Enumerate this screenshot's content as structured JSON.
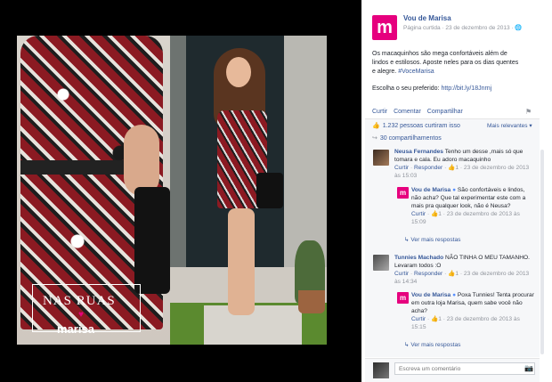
{
  "photo": {
    "brand_title": "NAS RUAS",
    "brand_logo": "marisa"
  },
  "post": {
    "page_logo_letter": "m",
    "page_name": "Vou de Marisa",
    "meta": "Página curtida · 23 de dezembro de 2013 ·",
    "text_line1": "Os macaquinhos são mega confortáveis além de",
    "text_line2": "lindos e estilosos. Aposte neles para os dias quentes",
    "text_line3": "e alegre.",
    "hashtag": "#VoceMarisa",
    "cta_text": "Escolha o seu preferido:",
    "cta_link": "http://bit.ly/18Jnrnj",
    "actions": [
      "Curtir",
      "Comentar",
      "Compartilhar"
    ],
    "likes": "1.232 pessoas curtiram isso",
    "relevance": "Mais relevantes ▾",
    "shares": "30 compartilhamentos"
  },
  "comments": [
    {
      "name": "Neusa Fernandes",
      "text": "Tenho um desse ,mais só que tomara e cala. Eu adoro macaquinho",
      "meta_links": [
        "Curtir",
        "Responder"
      ],
      "meta_count": "1",
      "date": "23 de dezembro de 2013 às 15:03"
    },
    {
      "name": "Vou de Marisa",
      "text": "São confortáveis e lindos, não acha? Que tal experimentar este com a mais pra qualquer look, não é Neusa?",
      "meta_links": [
        "Curtir"
      ],
      "meta_count": "1",
      "date": "23 de dezembro de 2013 às 15:09",
      "replies": "Ver mais respostas"
    },
    {
      "name": "Tunnies Machado",
      "text": "NÃO TINHA O MEU TAMANHO. Levaram todos :O",
      "meta_links": [
        "Curtir",
        "Responder"
      ],
      "meta_count": "1",
      "date": "23 de dezembro de 2013 às 14:34"
    },
    {
      "name": "Vou de Marisa",
      "text": "Poxa Tunnies! Tenta procurar em outra loja Marisa, quem sabe você não acha?",
      "meta_links": [
        "Curtir"
      ],
      "meta_count": "1",
      "date": "23 de dezembro de 2013 às 15:15",
      "replies": "Ver mais respostas"
    }
  ],
  "composer": {
    "placeholder": "Escreva um comentário"
  },
  "colors": {
    "brand": "#e6007e",
    "link": "#365899",
    "muted": "#90949c"
  }
}
